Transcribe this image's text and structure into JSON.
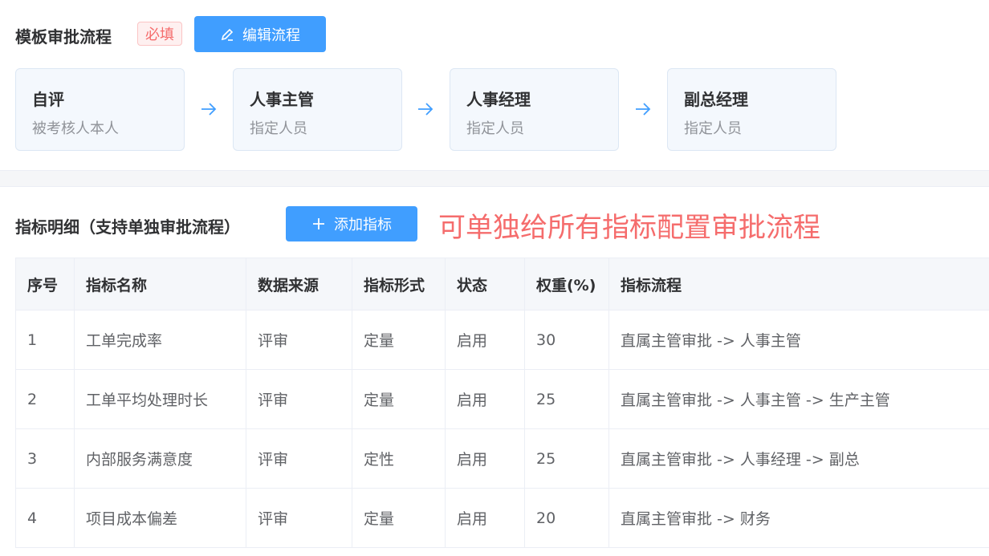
{
  "template_flow": {
    "title": "模板审批流程",
    "required_badge": "必填",
    "edit_button": "编辑流程",
    "steps": [
      {
        "title": "自评",
        "subtitle": "被考核人本人"
      },
      {
        "title": "人事主管",
        "subtitle": "指定人员"
      },
      {
        "title": "人事经理",
        "subtitle": "指定人员"
      },
      {
        "title": "副总经理",
        "subtitle": "指定人员"
      }
    ],
    "icons": {
      "edit": "pencil-icon",
      "arrow": "arrow-right-icon"
    }
  },
  "indicator_detail": {
    "title": "指标明细（支持单独审批流程）",
    "add_button": "添加指标",
    "note": "可单独给所有指标配置审批流程",
    "icons": {
      "add": "plus-icon"
    }
  },
  "table": {
    "columns": [
      "序号",
      "指标名称",
      "数据来源",
      "指标形式",
      "状态",
      "权重(%)",
      "指标流程"
    ],
    "rows": [
      [
        "1",
        "工单完成率",
        "评审",
        "定量",
        "启用",
        "30",
        "直属主管审批 -> 人事主管"
      ],
      [
        "2",
        "工单平均处理时长",
        "评审",
        "定量",
        "启用",
        "25",
        "直属主管审批 -> 人事主管 -> 生产主管"
      ],
      [
        "3",
        "内部服务满意度",
        "评审",
        "定性",
        "启用",
        "25",
        "直属主管审批 -> 人事经理 -> 副总"
      ],
      [
        "4",
        "项目成本偏差",
        "评审",
        "定量",
        "启用",
        "20",
        "直属主管审批 -> 财务"
      ]
    ]
  },
  "colors": {
    "primary": "#409eff",
    "danger": "#f56c6c",
    "step_bg": "#f4f8fd"
  }
}
